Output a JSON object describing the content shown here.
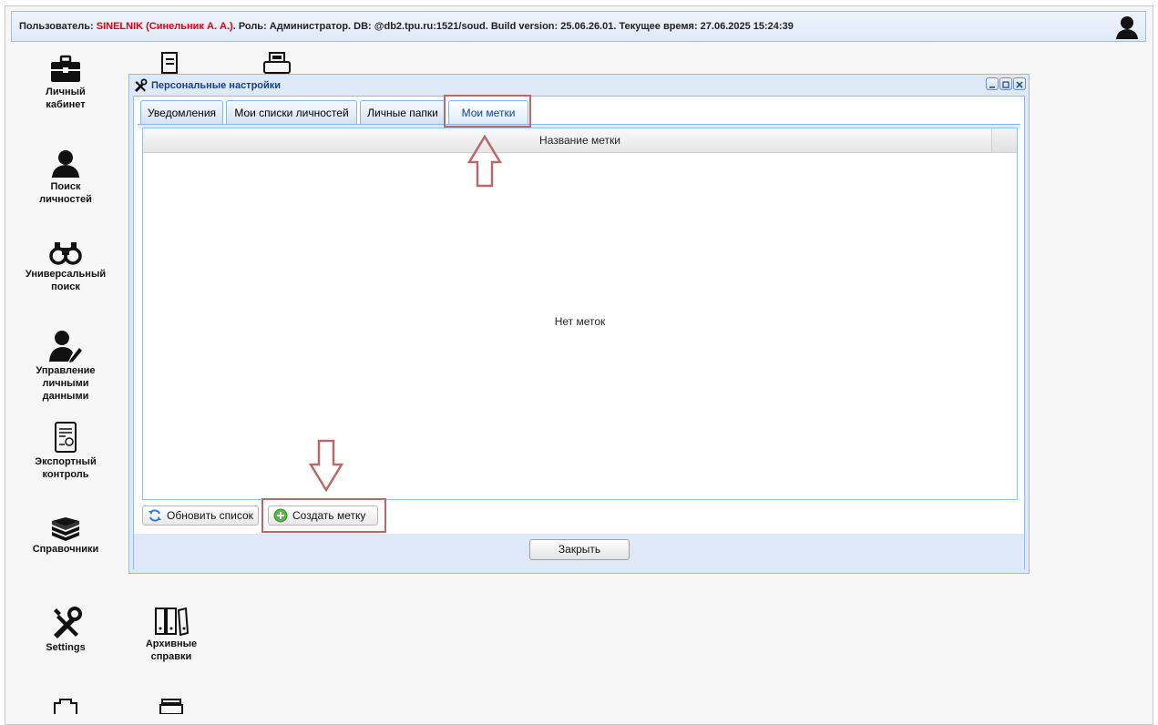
{
  "topbar": {
    "prefix": "Пользователь: ",
    "user": "SINELNIK (Синельник А. А.)",
    "suffix": ". Роль: Администратор. DB: @db2.tpu.ru:1521/soud. Build version: 25.06.26.01. Текущее время: 27.06.2025 15:24:39"
  },
  "desktop": {
    "cabinet": "Личный\nкабинет",
    "person_search": "Поиск\nличностей",
    "universal_search": "Универсальный\nпоиск",
    "personal_data": "Управление\nличными\nданными",
    "export_control": "Экспортный\nконтроль",
    "references": "Справочники",
    "settings": "Settings",
    "archive": "Архивные\nсправки"
  },
  "window": {
    "title": "Персональные настройки",
    "tabs": [
      "Уведомления",
      "Мои списки личностей",
      "Личные папки",
      "Мои метки"
    ],
    "active_tab": 3,
    "grid": {
      "column": "Название метки",
      "empty_text": "Нет меток"
    },
    "toolbar": {
      "refresh": "Обновить список",
      "create": "Создать метку"
    },
    "close": "Закрыть"
  },
  "colors": {
    "accent_red": "#e0000b",
    "window_blue": "#99bbe8",
    "annotation": "#b86a6a"
  }
}
